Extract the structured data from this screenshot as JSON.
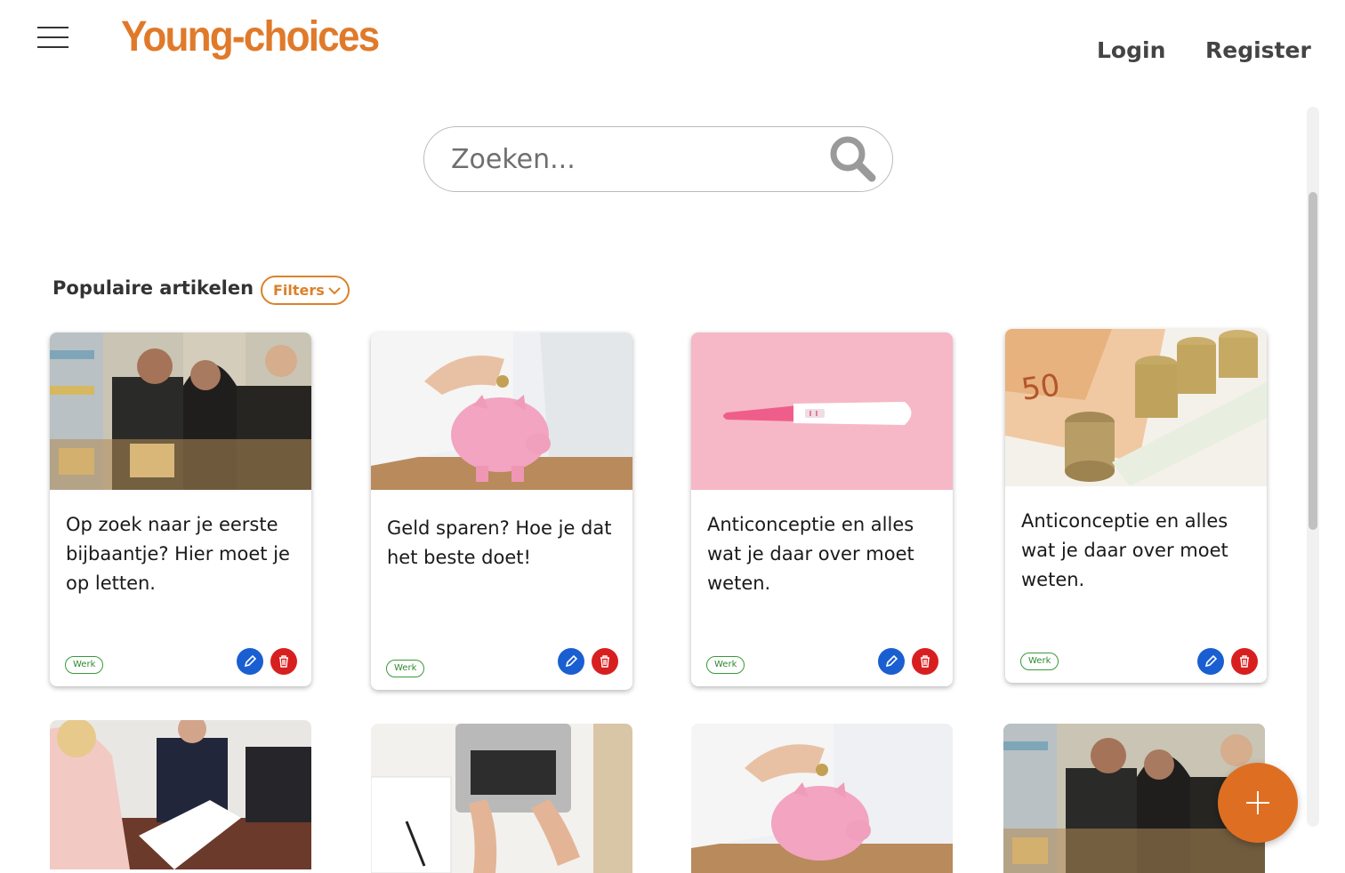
{
  "header": {
    "logo": "Young-choices",
    "login": "Login",
    "register": "Register"
  },
  "search": {
    "placeholder": "Zoeken..."
  },
  "section": {
    "title": "Populaire artikelen",
    "filters_label": "Filters"
  },
  "articles": [
    {
      "title": "Op zoek naar je eerste bijbaantje? Hier moet je op letten.",
      "tag": "Werk",
      "image": "supermarket-workers-photo"
    },
    {
      "title": "Geld sparen? Hoe je dat het beste doet!",
      "tag": "Werk",
      "image": "piggy-bank-photo"
    },
    {
      "title": "Anticonceptie en alles wat je daar over moet weten.",
      "tag": "Werk",
      "image": "pregnancy-test-photo"
    },
    {
      "title": "Anticonceptie en alles wat je daar over moet weten.",
      "tag": "Werk",
      "image": "euro-coins-photo"
    }
  ],
  "row2_images": [
    "job-interview-photo",
    "laptop-desk-photo",
    "piggy-bank-photo",
    "supermarket-workers-photo"
  ],
  "colors": {
    "brand": "#e07a2a",
    "fab": "#de6f22",
    "edit": "#1a5fd1",
    "delete": "#d81f1f",
    "tag": "#2f8a2f"
  }
}
